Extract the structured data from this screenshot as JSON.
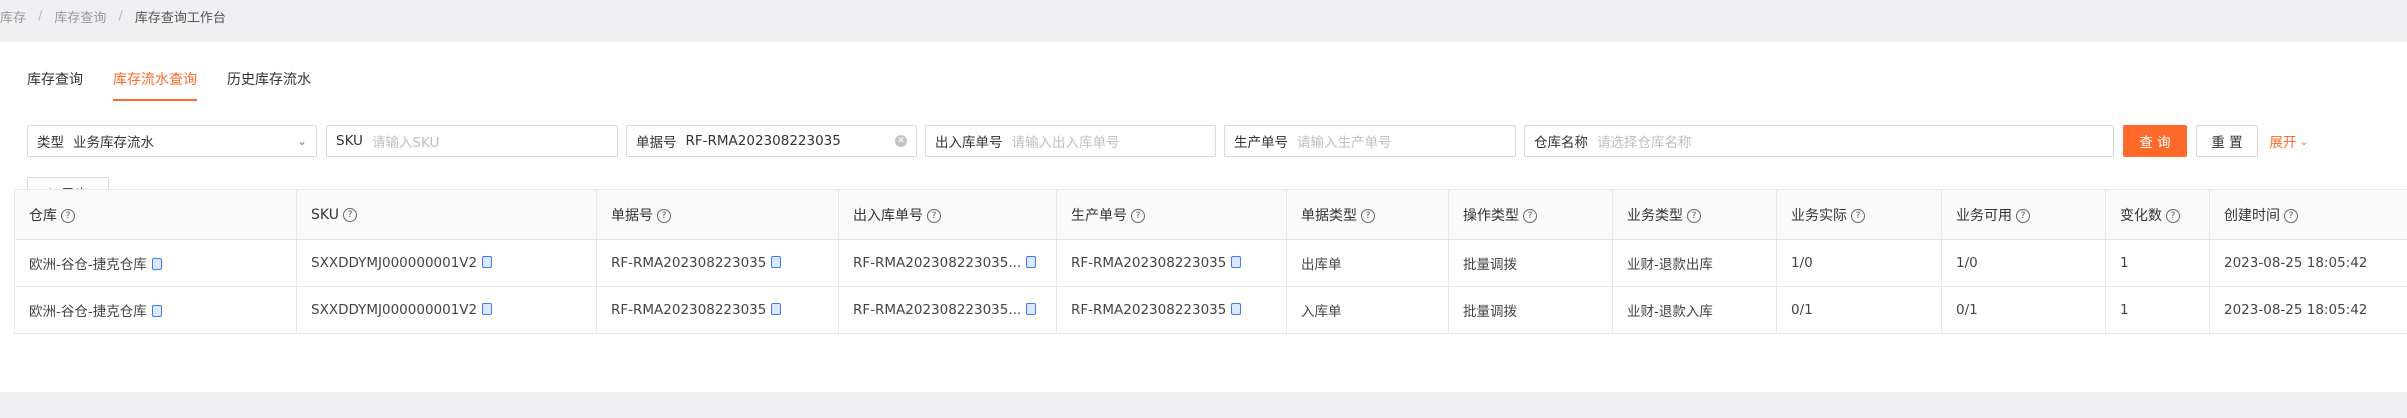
{
  "breadcrumb": [
    "库存",
    "库存查询",
    "库存查询工作台"
  ],
  "tabs": [
    "库存查询",
    "库存流水查询",
    "历史库存流水"
  ],
  "filters": {
    "type": {
      "label": "类型",
      "value": "业务库存流水"
    },
    "sku": {
      "label": "SKU",
      "placeholder": "请输入SKU"
    },
    "doc_no": {
      "label": "单据号",
      "value": "RF-RMA202308223035"
    },
    "io_no": {
      "label": "出入库单号",
      "placeholder": "请输入出入库单号"
    },
    "prod_no": {
      "label": "生产单号",
      "placeholder": "请输入生产单号"
    },
    "warehouse": {
      "label": "仓库名称",
      "placeholder": "请选择仓库名称"
    }
  },
  "buttons": {
    "query": "查 询",
    "reset": "重 置",
    "expand": "展开",
    "export": "导出"
  },
  "table": {
    "headers": [
      "仓库",
      "SKU",
      "单据号",
      "出入库单号",
      "生产单号",
      "单据类型",
      "操作类型",
      "业务类型",
      "业务实际",
      "业务可用",
      "变化数",
      "创建时间"
    ],
    "rows": [
      [
        "欧洲-谷仓-捷克仓库",
        "SXXDDYMJ000000001V2",
        "RF-RMA202308223035",
        "RF-RMA202308223035...",
        "RF-RMA202308223035",
        "出库单",
        "批量调拨",
        "业财-退款出库",
        "1/0",
        "1/0",
        "1",
        "2023-08-25 18:05:42"
      ],
      [
        "欧洲-谷仓-捷克仓库",
        "SXXDDYMJ000000001V2",
        "RF-RMA202308223035",
        "RF-RMA202308223035...",
        "RF-RMA202308223035",
        "入库单",
        "批量调拨",
        "业财-退款入库",
        "0/1",
        "0/1",
        "1",
        "2023-08-25 18:05:42"
      ]
    ]
  },
  "colors": {
    "accent": "#ff6a2a",
    "copy_icon": "#3b7bf5"
  }
}
